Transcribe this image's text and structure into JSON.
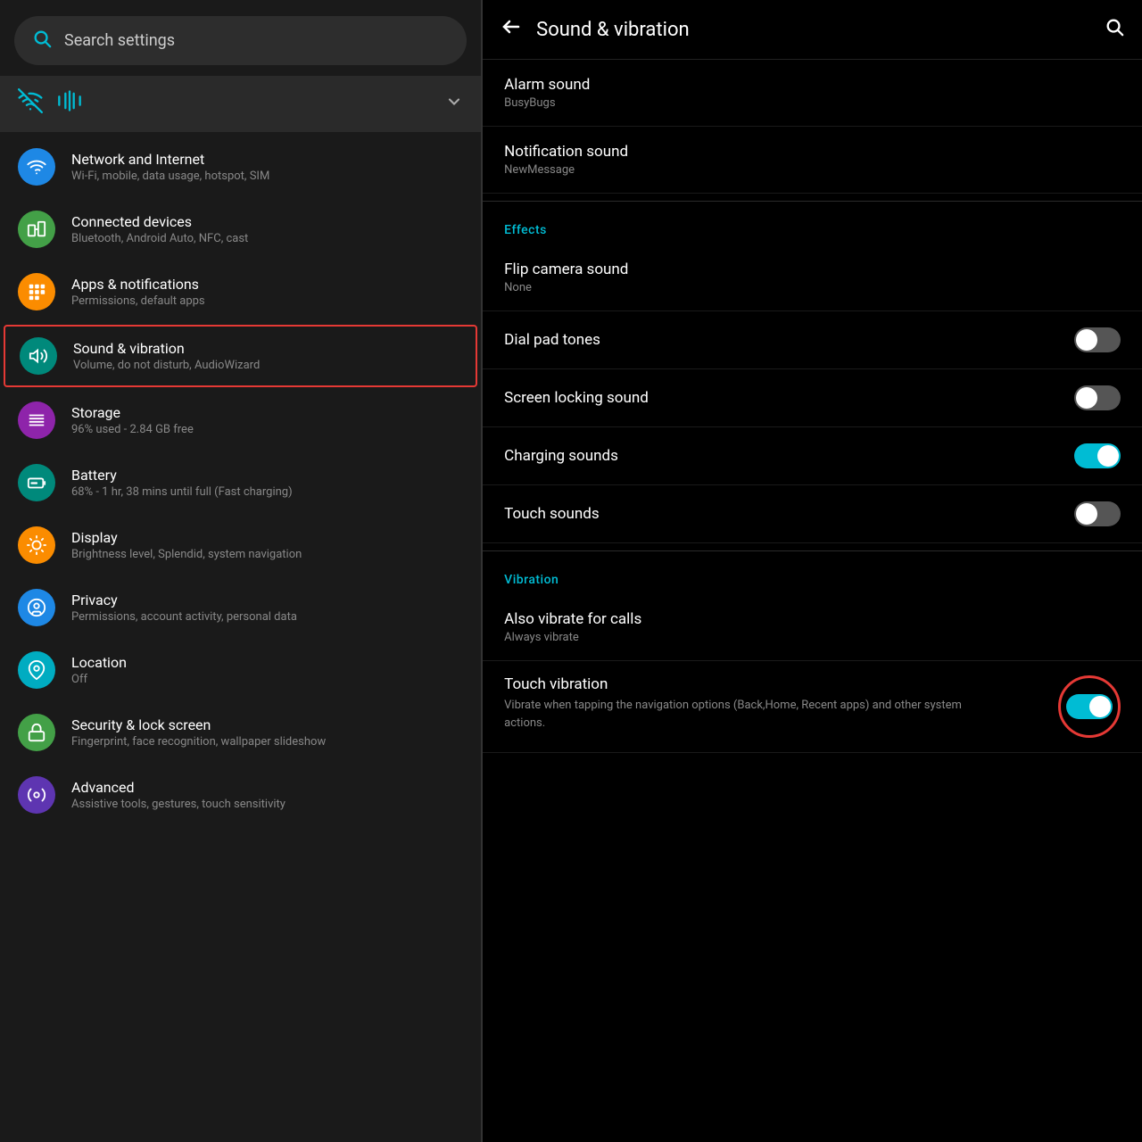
{
  "left": {
    "search": {
      "placeholder": "Search settings"
    },
    "sound_banner": {
      "icon1": "📶",
      "icon2": "📳"
    },
    "items": [
      {
        "id": "network",
        "title": "Network and Internet",
        "subtitle": "Wi-Fi, mobile, data usage, hotspot, SIM",
        "icon": "wifi",
        "iconBg": "#1e88e5",
        "emoji": "📶"
      },
      {
        "id": "connected",
        "title": "Connected devices",
        "subtitle": "Bluetooth, Android Auto, NFC, cast",
        "icon": "devices",
        "iconBg": "#43a047",
        "emoji": "📡"
      },
      {
        "id": "apps",
        "title": "Apps & notifications",
        "subtitle": "Permissions, default apps",
        "icon": "apps",
        "iconBg": "#fb8c00",
        "emoji": "⋮⋮⋮"
      },
      {
        "id": "sound",
        "title": "Sound & vibration",
        "subtitle": "Volume, do not disturb, AudioWizard",
        "icon": "volume_up",
        "iconBg": "#00897b",
        "emoji": "🔊",
        "active": true
      },
      {
        "id": "storage",
        "title": "Storage",
        "subtitle": "96% used - 2.84 GB free",
        "icon": "storage",
        "iconBg": "#8e24aa",
        "emoji": "≡"
      },
      {
        "id": "battery",
        "title": "Battery",
        "subtitle": "68% - 1 hr, 38 mins until full (Fast charging)",
        "icon": "battery",
        "iconBg": "#00897b",
        "emoji": "🔋"
      },
      {
        "id": "display",
        "title": "Display",
        "subtitle": "Brightness level, Splendid, system navigation",
        "icon": "display",
        "iconBg": "#fb8c00",
        "emoji": "☀"
      },
      {
        "id": "privacy",
        "title": "Privacy",
        "subtitle": "Permissions, account activity, personal data",
        "icon": "privacy",
        "iconBg": "#1e88e5",
        "emoji": "👁"
      },
      {
        "id": "location",
        "title": "Location",
        "subtitle": "Off",
        "icon": "location",
        "iconBg": "#00acc1",
        "emoji": "📍"
      },
      {
        "id": "security",
        "title": "Security & lock screen",
        "subtitle": "Fingerprint, face recognition, wallpaper slideshow",
        "icon": "security",
        "iconBg": "#43a047",
        "emoji": "🔒"
      },
      {
        "id": "advanced",
        "title": "Advanced",
        "subtitle": "Assistive tools, gestures, touch sensitivity",
        "icon": "advanced",
        "iconBg": "#5e35b1",
        "emoji": "⚙"
      }
    ]
  },
  "right": {
    "title": "Sound & vibration",
    "settings": [
      {
        "label": "Alarm sound",
        "sublabel": "BusyBugs",
        "type": "nav"
      },
      {
        "label": "Notification sound",
        "sublabel": "NewMessage",
        "type": "nav"
      }
    ],
    "effects_section": "Effects",
    "effects": [
      {
        "label": "Flip camera sound",
        "sublabel": "None",
        "type": "nav"
      },
      {
        "label": "Dial pad tones",
        "type": "toggle",
        "state": "off"
      },
      {
        "label": "Screen locking sound",
        "type": "toggle",
        "state": "off"
      },
      {
        "label": "Charging sounds",
        "type": "toggle",
        "state": "on"
      },
      {
        "label": "Touch sounds",
        "type": "toggle",
        "state": "off"
      }
    ],
    "vibration_section": "Vibration",
    "vibration": [
      {
        "label": "Also vibrate for calls",
        "sublabel": "Always vibrate",
        "type": "nav"
      },
      {
        "label": "Touch vibration",
        "sublabel": "Vibrate when tapping the navigation options (Back,Home, Recent apps) and other system actions.",
        "type": "toggle",
        "state": "on",
        "highlighted": true
      }
    ]
  }
}
